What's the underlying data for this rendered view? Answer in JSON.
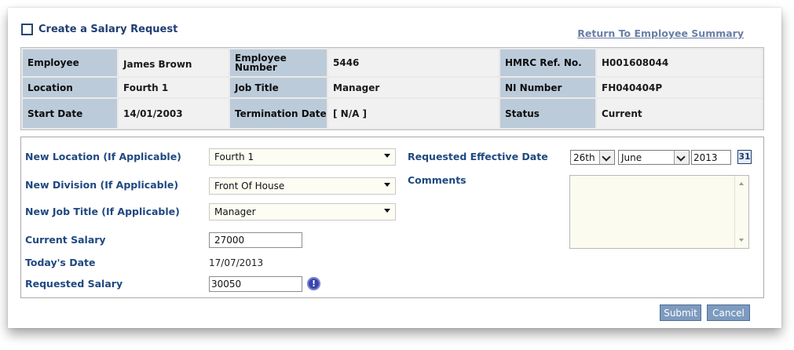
{
  "header": {
    "title": "Create a Salary Request",
    "return_link": "Return To Employee Summary"
  },
  "employee_info": {
    "employee_label": "Employee",
    "employee_value": "James Brown",
    "employee_number_label": "Employee Number",
    "employee_number_value": "5446",
    "hmrc_label": "HMRC Ref. No.",
    "hmrc_value": "H001608044",
    "location_label": "Location",
    "location_value": "Fourth 1",
    "job_title_label": "Job Title",
    "job_title_value": "Manager",
    "ni_label": "NI Number",
    "ni_value": "FH040404P",
    "start_date_label": "Start Date",
    "start_date_value": "14/01/2003",
    "termination_label": "Termination Date",
    "termination_value": "[ N/A ]",
    "status_label": "Status",
    "status_value": "Current"
  },
  "form": {
    "new_location_label": "New Location (If Applicable)",
    "new_location_value": "Fourth 1",
    "new_division_label": "New Division (If Applicable)",
    "new_division_value": "Front Of House",
    "new_job_title_label": "New Job Title (If Applicable)",
    "new_job_title_value": "Manager",
    "current_salary_label": "Current Salary",
    "current_salary_value": "27000",
    "todays_date_label": "Today's Date",
    "todays_date_value": "17/07/2013",
    "requested_salary_label": "Requested Salary",
    "requested_salary_value": "30050",
    "effective_date_label": "Requested Effective Date",
    "effective_day": "26th",
    "effective_month": "June",
    "effective_year": "2013",
    "calendar_icon_text": "31",
    "comments_label": "Comments",
    "comments_value": ""
  },
  "buttons": {
    "submit": "Submit",
    "cancel": "Cancel"
  },
  "icons": {
    "title_checkbox": "checkbox-icon",
    "calendar": "calendar-icon",
    "warning": "info-exclamation-icon"
  },
  "colors": {
    "label_bg": "#bccbd9",
    "title_text": "#1f3e72",
    "form_label": "#1f4880",
    "button_bg": "#7d9bbf"
  }
}
